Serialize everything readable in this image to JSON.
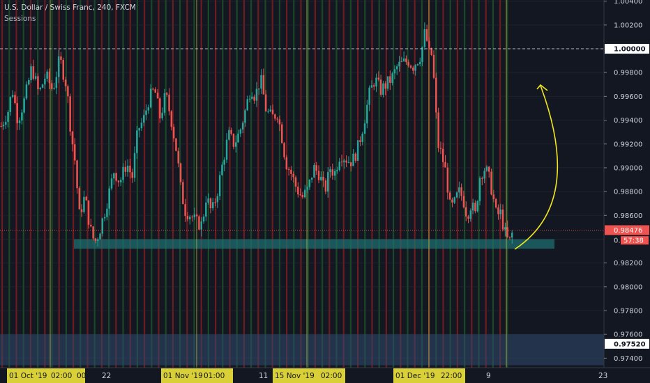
{
  "header": {
    "symbol_title": "U.S. Dollar / Swiss Franc, 240, FXCM",
    "indicator": "Sessions"
  },
  "colors": {
    "background": "#131722",
    "bull": "#26a69a",
    "bear": "#ef5350",
    "session_red": "#8b1e1e",
    "session_green": "#1e5a2a",
    "gridline": "#2a2e39",
    "vline": "#c9c23a",
    "zone": "#1f6e6e",
    "arrow": "#f2e51f",
    "hline": "#d1d4dc"
  },
  "chart_data": {
    "type": "candlestick",
    "ylim": [
      0.9732,
      1.0041
    ],
    "y_ticks": [
      "1.00400",
      "1.00200",
      "0.99800",
      "0.99600",
      "0.99400",
      "0.99200",
      "0.99000",
      "0.98800",
      "0.98600",
      "0.98200",
      "0.98000",
      "0.97800",
      "0.97600",
      "0.97400"
    ],
    "highlight_ticks": [
      {
        "label": "1.00000",
        "value": 1.0,
        "style": "white"
      },
      {
        "label": "0.98476",
        "value": 0.98476,
        "style": "red"
      },
      {
        "label": "0.",
        "countdown": "57:38",
        "value": 0.9839,
        "style": "countdown"
      },
      {
        "label": "0.97520",
        "value": 0.9752,
        "style": "white"
      }
    ],
    "x_labels": [
      "01 Oct '19",
      "02:00",
      "00",
      "22",
      "01 Nov '19",
      "01:00",
      "11",
      "15 Nov '19",
      "02:00",
      "01 Dec '19",
      "22:00",
      "9",
      "23"
    ],
    "path": [
      [
        0,
        0.9935
      ],
      [
        10,
        0.9948
      ],
      [
        16,
        0.9966
      ],
      [
        24,
        0.994
      ],
      [
        34,
        0.9958
      ],
      [
        44,
        0.9985
      ],
      [
        54,
        0.9962
      ],
      [
        64,
        0.9978
      ],
      [
        74,
        0.9965
      ],
      [
        84,
        0.9992
      ],
      [
        94,
        0.9968
      ],
      [
        100,
        0.993
      ],
      [
        106,
        0.9905
      ],
      [
        112,
        0.986
      ],
      [
        120,
        0.9876
      ],
      [
        128,
        0.9848
      ],
      [
        134,
        0.9837
      ],
      [
        140,
        0.9845
      ],
      [
        148,
        0.9862
      ],
      [
        156,
        0.9882
      ],
      [
        162,
        0.9898
      ],
      [
        170,
        0.9888
      ],
      [
        180,
        0.9904
      ],
      [
        188,
        0.9892
      ],
      [
        196,
        0.9932
      ],
      [
        204,
        0.994
      ],
      [
        212,
        0.9958
      ],
      [
        220,
        0.9966
      ],
      [
        228,
        0.9942
      ],
      [
        236,
        0.9962
      ],
      [
        244,
        0.994
      ],
      [
        252,
        0.9912
      ],
      [
        258,
        0.988
      ],
      [
        264,
        0.9864
      ],
      [
        272,
        0.986
      ],
      [
        280,
        0.9854
      ],
      [
        288,
        0.9852
      ],
      [
        294,
        0.9876
      ],
      [
        302,
        0.9862
      ],
      [
        310,
        0.988
      ],
      [
        318,
        0.9905
      ],
      [
        326,
        0.9928
      ],
      [
        334,
        0.992
      ],
      [
        342,
        0.993
      ],
      [
        350,
        0.9948
      ],
      [
        358,
        0.9968
      ],
      [
        364,
        0.996
      ],
      [
        372,
        0.9975
      ],
      [
        380,
        0.9948
      ],
      [
        388,
        0.9942
      ],
      [
        396,
        0.9946
      ],
      [
        402,
        0.9928
      ],
      [
        408,
        0.9905
      ],
      [
        416,
        0.9895
      ],
      [
        424,
        0.9882
      ],
      [
        432,
        0.9875
      ],
      [
        440,
        0.9882
      ],
      [
        448,
        0.99
      ],
      [
        456,
        0.9895
      ],
      [
        464,
        0.988
      ],
      [
        472,
        0.99
      ],
      [
        478,
        0.9895
      ],
      [
        486,
        0.9912
      ],
      [
        494,
        0.9908
      ],
      [
        500,
        0.9905
      ],
      [
        506,
        0.9908
      ],
      [
        512,
        0.9918
      ],
      [
        520,
        0.9938
      ],
      [
        528,
        0.9962
      ],
      [
        536,
        0.9975
      ],
      [
        544,
        0.9965
      ],
      [
        552,
        0.997
      ],
      [
        560,
        0.9975
      ],
      [
        568,
        0.9985
      ],
      [
        576,
        0.9988
      ],
      [
        584,
        0.999
      ],
      [
        590,
        0.9985
      ],
      [
        596,
        0.999
      ],
      [
        602,
        0.9995
      ],
      [
        608,
        1.0015
      ],
      [
        614,
        0.9995
      ],
      [
        618,
        0.9995
      ],
      [
        622,
        0.996
      ],
      [
        626,
        0.992
      ],
      [
        632,
        0.991
      ],
      [
        638,
        0.9895
      ],
      [
        644,
        0.9865
      ],
      [
        650,
        0.987
      ],
      [
        656,
        0.988
      ],
      [
        662,
        0.9875
      ],
      [
        668,
        0.986
      ],
      [
        674,
        0.987
      ],
      [
        680,
        0.986
      ],
      [
        686,
        0.9892
      ],
      [
        692,
        0.99
      ],
      [
        698,
        0.9895
      ],
      [
        704,
        0.988
      ],
      [
        710,
        0.986
      ],
      [
        716,
        0.9862
      ],
      [
        722,
        0.9846
      ],
      [
        726,
        0.984
      ],
      [
        730,
        0.9838
      ],
      [
        734,
        0.9848
      ]
    ],
    "support_zone": {
      "x_start": 106,
      "x_end": 795,
      "y_top": 0.984,
      "y_bottom": 0.9832
    },
    "bottom_zone": {
      "y_top": 0.976,
      "y_bottom": 0.9734
    },
    "horizontal_line": 1.0,
    "last_price": 0.98476,
    "session_vlines_x": [
      72,
      282,
      440,
      615,
      726
    ]
  }
}
